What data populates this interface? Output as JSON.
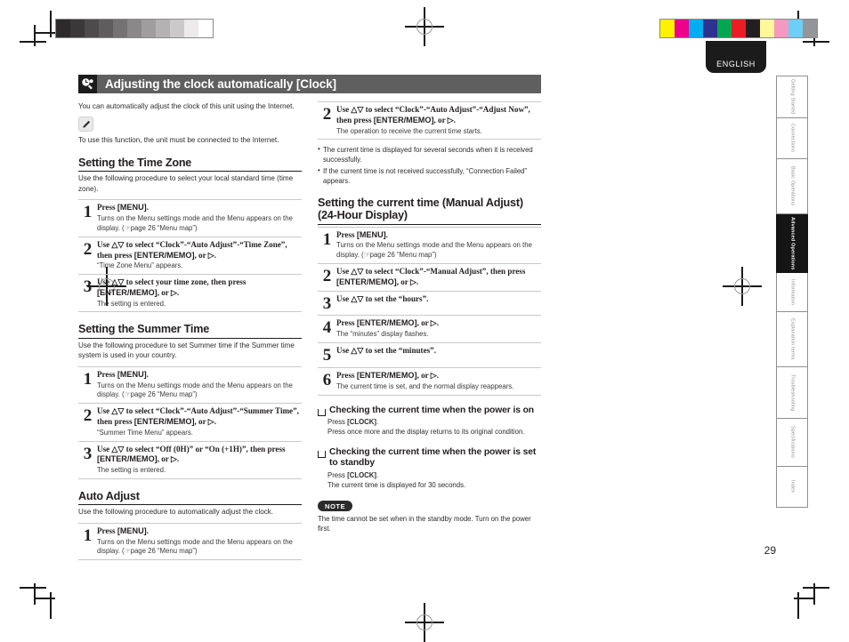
{
  "page": {
    "language_tab": "ENGLISH",
    "page_number": "29",
    "section_icon": "clock-settings-icon"
  },
  "section": {
    "title": "Adjusting the clock automatically [Clock]"
  },
  "intro": {
    "paragraph": "You can automatically adjust the clock of this unit using the Internet.",
    "tip_icon": "pencil-icon",
    "tip_text": "To use this function, the unit must be connected to the Internet."
  },
  "left_column": {
    "time_zone": {
      "heading": "Setting the Time Zone",
      "intro": "Use the following procedure to select your local standard time (time zone).",
      "steps": [
        {
          "num": "1",
          "lead": "Press [MENU].",
          "note": "Turns on the Menu settings mode and the Menu appears on the display. (☞page 26 “Menu map”)"
        },
        {
          "num": "2",
          "lead": "Use △▽ to select “Clock”-“Auto Adjust”-“Time Zone”, then press [ENTER/MEMO], <ENTER> or ▷.",
          "note": "“Time Zone Menu” appears."
        },
        {
          "num": "3",
          "lead": "Use △▽ to select your time zone, then press [ENTER/MEMO], <ENTER> or ▷.",
          "note": "The setting is entered."
        }
      ]
    },
    "summer_time": {
      "heading": "Setting the Summer Time",
      "intro": "Use the following procedure to set Summer time if the Summer time system is used in your country.",
      "steps": [
        {
          "num": "1",
          "lead": "Press [MENU].",
          "note": "Turns on the Menu settings mode and the Menu appears on the display. (☞page 26 “Menu map”)"
        },
        {
          "num": "2",
          "lead": "Use △▽ to select “Clock”-“Auto Adjust”-“Summer Time”, then press [ENTER/MEMO], <ENTER> or ▷.",
          "note": "“Summer Time Menu” appears."
        },
        {
          "num": "3",
          "lead": "Use △▽ to select “Off (0H)” or “On (+1H)”, then press [ENTER/MEMO], <ENTER> or ▷.",
          "note": "The setting is entered."
        }
      ]
    },
    "auto_adjust": {
      "heading": "Auto Adjust",
      "intro": "Use the following procedure to automatically adjust the clock.",
      "steps": [
        {
          "num": "1",
          "lead": "Press [MENU].",
          "note": "Turns on the Menu settings mode and the Menu appears on the display. (☞page 26 “Menu map”)"
        }
      ]
    }
  },
  "right_column": {
    "auto_adjust_cont": {
      "steps": [
        {
          "num": "2",
          "lead": "Use △▽ to select “Clock”-“Auto Adjust”-“Adjust Now”, then press [ENTER/MEMO], <ENTER> or ▷.",
          "note": "The operation to receive the current time starts."
        }
      ],
      "bullets": [
        "The current time is displayed for several seconds when it is received successfully.",
        "If the current time is not received successfully, “Connection Failed” appears."
      ]
    },
    "manual_adjust": {
      "heading_line1": "Setting the current time (Manual Adjust)",
      "heading_line2": "(24-Hour Display)",
      "steps": [
        {
          "num": "1",
          "lead": "Press [MENU].",
          "note": "Turns on the Menu settings mode and the Menu appears on the display. (☞page 26 “Menu map”)"
        },
        {
          "num": "2",
          "lead": "Use △▽ to select “Clock”-“Manual Adjust”, then press [ENTER/MEMO], <ENTER> or ▷.",
          "note": ""
        },
        {
          "num": "3",
          "lead": "Use △▽ to set the “hours”.",
          "note": ""
        },
        {
          "num": "4",
          "lead": "Press [ENTER/MEMO], <ENTER> or ▷.",
          "note": "The “minutes” display flashes."
        },
        {
          "num": "5",
          "lead": "Use △▽ to set the “minutes”.",
          "note": ""
        },
        {
          "num": "6",
          "lead": "Press [ENTER/MEMO], <ENTER> or ▷.",
          "note": "The current time is set, and the normal display reappears."
        }
      ]
    },
    "checks": [
      {
        "heading": "Checking the current time when the power is on",
        "line1_pre": "Press ",
        "line1_key": "[CLOCK]",
        "line1_post": ".",
        "line2": "Press once more and the display returns to its original condition."
      },
      {
        "heading": "Checking the current time when the power is set to standby",
        "line1_pre": "Press ",
        "line1_key": "[CLOCK]",
        "line1_post": ".",
        "line2": "The current time is displayed for 30 seconds."
      }
    ],
    "note": {
      "badge": "NOTE",
      "text": "The time cannot be set when in the standby mode. Turn on the power first."
    }
  },
  "side_tabs": [
    {
      "label": "Getting Started",
      "active": false
    },
    {
      "label": "Connections",
      "active": false
    },
    {
      "label": "Basic Operations",
      "active": false
    },
    {
      "label": "Advanced Operations",
      "active": true
    },
    {
      "label": "Information",
      "active": false
    },
    {
      "label": "Explanation terms",
      "active": false
    },
    {
      "label": "Troubleshooting",
      "active": false
    },
    {
      "label": "Specifications",
      "active": false
    },
    {
      "label": "Index",
      "active": false
    }
  ],
  "calibration": {
    "gray_bar": [
      "#2d2a2b",
      "#3b3839",
      "#4e4b4c",
      "#605d5e",
      "#757273",
      "#8b8889",
      "#a09d9e",
      "#b5b2b3",
      "#cbc9ca",
      "#eceaea",
      "#ffffff"
    ],
    "color_bar": [
      "#fff200",
      "#ec008c",
      "#00aeef",
      "#2e3192",
      "#00a651",
      "#ed1c24",
      "#231f20",
      "#fff79a",
      "#f49ac1",
      "#6dcff6",
      "#939598"
    ]
  }
}
